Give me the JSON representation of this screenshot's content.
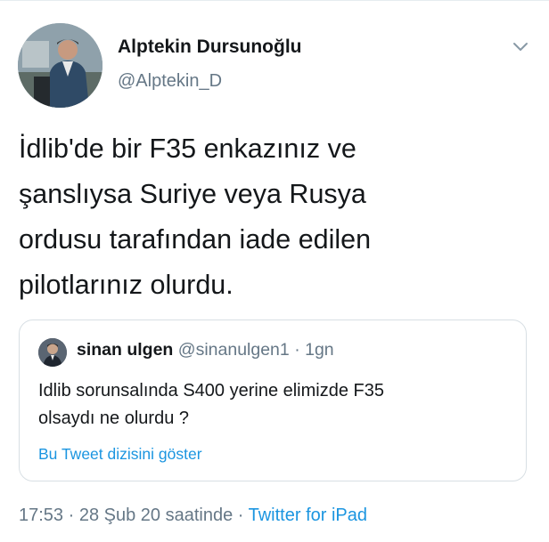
{
  "tweet": {
    "author": {
      "display_name": "Alptekin Dursunoğlu",
      "handle": "@Alptekin_D"
    },
    "text": "İdlib'de bir F35 enkazınız ve\nşanslıysa Suriye veya Rusya\nordusu tarafından iade edilen\npilotlarınız olurdu.",
    "quoted": {
      "display_name": "sinan ulgen",
      "handle": "@sinanulgen1",
      "separator": "·",
      "time": "1gn",
      "text": "Idlib sorunsalında S400 yerine elimizde F35\nolsaydı ne olurdu ?",
      "thread_link": "Bu Tweet dizisini göster"
    },
    "meta": {
      "timestamp": "17:53 · 28 Şub 20 saatinde",
      "separator": "·",
      "source": "Twitter for iPad"
    }
  },
  "icons": {
    "menu": "chevron-down-icon"
  },
  "colors": {
    "text_primary": "#14171a",
    "text_secondary": "#657786",
    "link": "#1b95e0",
    "border": "#d8dfe4"
  }
}
